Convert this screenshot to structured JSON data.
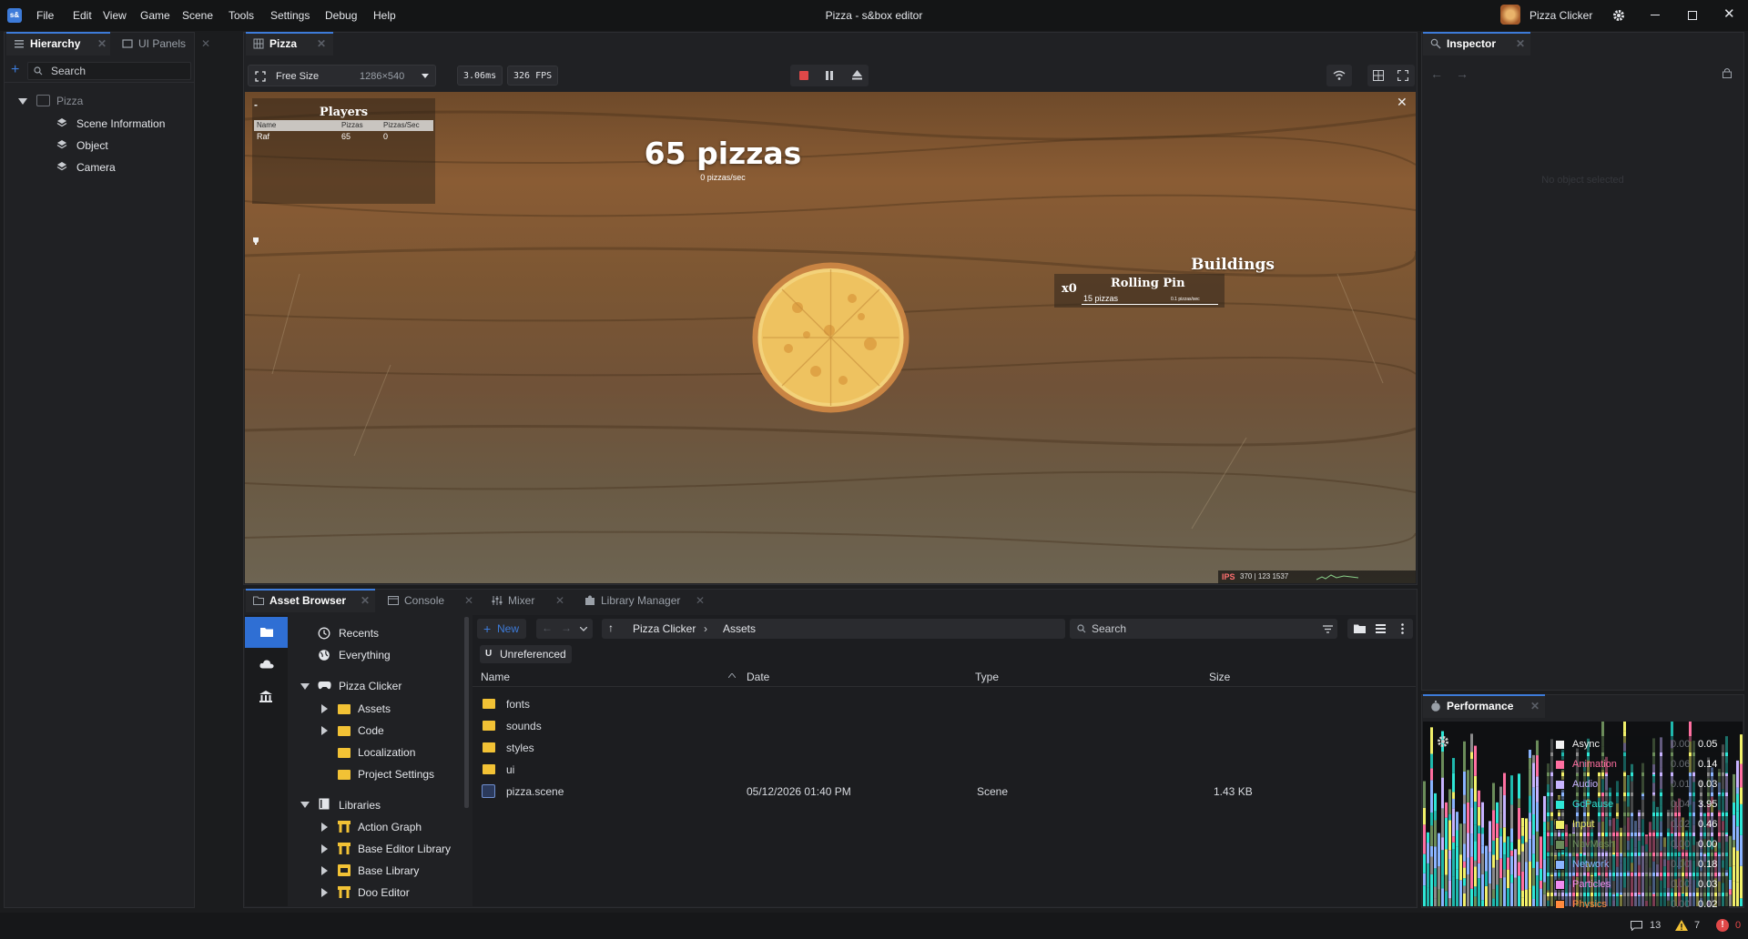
{
  "app": {
    "title": "Pizza - s&box editor",
    "logo": "s&",
    "project_name": "Pizza Clicker"
  },
  "menu": [
    "File",
    "Edit",
    "View",
    "Game",
    "Scene",
    "Tools",
    "Settings",
    "Debug",
    "Help"
  ],
  "hierarchy": {
    "tabs": [
      "Hierarchy",
      "UI Panels"
    ],
    "search_placeholder": "Search",
    "root": "Pizza",
    "items": [
      "Scene Information",
      "Object",
      "Camera"
    ]
  },
  "viewport": {
    "tab": "Pizza",
    "size_mode": "Free Size",
    "resolution": "1286×540",
    "frame_time": "3.06ms",
    "fps": "326 FPS"
  },
  "game": {
    "players_title": "Players",
    "players_headers": [
      "Name",
      "Pizzas",
      "Pizzas/Sec"
    ],
    "players_rows": [
      [
        "Raf",
        "65",
        "0"
      ]
    ],
    "minus": "-",
    "pizza_count": "65 pizzas",
    "pizza_rate": "0 pizzas/sec",
    "buildings_title": "Buildings",
    "building": {
      "count": "x0",
      "name": "Rolling Pin",
      "cost": "15 pizzas",
      "rate": "0.1 pizzas/sec"
    },
    "ips_label": "IPS",
    "ips_values": "370 | 123 1537"
  },
  "inspector": {
    "tab": "Inspector",
    "empty_text": "No object selected"
  },
  "asset_browser": {
    "tabs": [
      "Asset Browser",
      "Console",
      "Mixer",
      "Library Manager"
    ],
    "new_label": "New",
    "breadcrumb": [
      "Pizza Clicker",
      "Assets"
    ],
    "search_placeholder": "Search",
    "filter_chip": "Unreferenced",
    "filter_chip_letter": "U",
    "tree": {
      "quick": [
        "Recents",
        "Everything"
      ],
      "project": "Pizza Clicker",
      "project_children": [
        "Assets",
        "Code",
        "Localization",
        "Project Settings"
      ],
      "libraries": "Libraries",
      "library_children": [
        "Action Graph",
        "Base Editor Library",
        "Base Library",
        "Doo Editor"
      ]
    },
    "columns": [
      "Name",
      "Date",
      "Type",
      "Size"
    ],
    "rows": [
      {
        "name": "fonts",
        "date": "",
        "type": "",
        "size": ""
      },
      {
        "name": "sounds",
        "date": "",
        "type": "",
        "size": ""
      },
      {
        "name": "styles",
        "date": "",
        "type": "",
        "size": ""
      },
      {
        "name": "ui",
        "date": "",
        "type": "",
        "size": ""
      },
      {
        "name": "pizza.scene",
        "date": "05/12/2026 01:40 PM",
        "type": "Scene",
        "size": "1.43 KB"
      }
    ]
  },
  "performance": {
    "tab": "Performance",
    "rows": [
      {
        "name": "Async",
        "v1": "0.00",
        "v2": "0.05",
        "color": "#f2f2f2"
      },
      {
        "name": "Animation",
        "v1": "0.06",
        "v2": "0.14",
        "color": "#ff6fa0"
      },
      {
        "name": "Audio",
        "v1": "0.01",
        "v2": "0.03",
        "color": "#c7b3ff"
      },
      {
        "name": "GcPause",
        "v1": "0.04",
        "v2": "3.95",
        "color": "#2ee6d6"
      },
      {
        "name": "Input",
        "v1": "0.02",
        "v2": "0.46",
        "color": "#f1f06a"
      },
      {
        "name": "NavMesh",
        "v1": "0.00",
        "v2": "0.00",
        "color": "#6b8c5a"
      },
      {
        "name": "Network",
        "v1": "0.00",
        "v2": "0.18",
        "color": "#8ab4ff"
      },
      {
        "name": "Particles",
        "v1": "0.00",
        "v2": "0.03",
        "color": "#f08cf0"
      },
      {
        "name": "Physics",
        "v1": "0.00",
        "v2": "0.02",
        "color": "#ff8a3d"
      }
    ]
  },
  "statusbar": {
    "messages": "13",
    "warnings": "7",
    "errors": "0"
  }
}
